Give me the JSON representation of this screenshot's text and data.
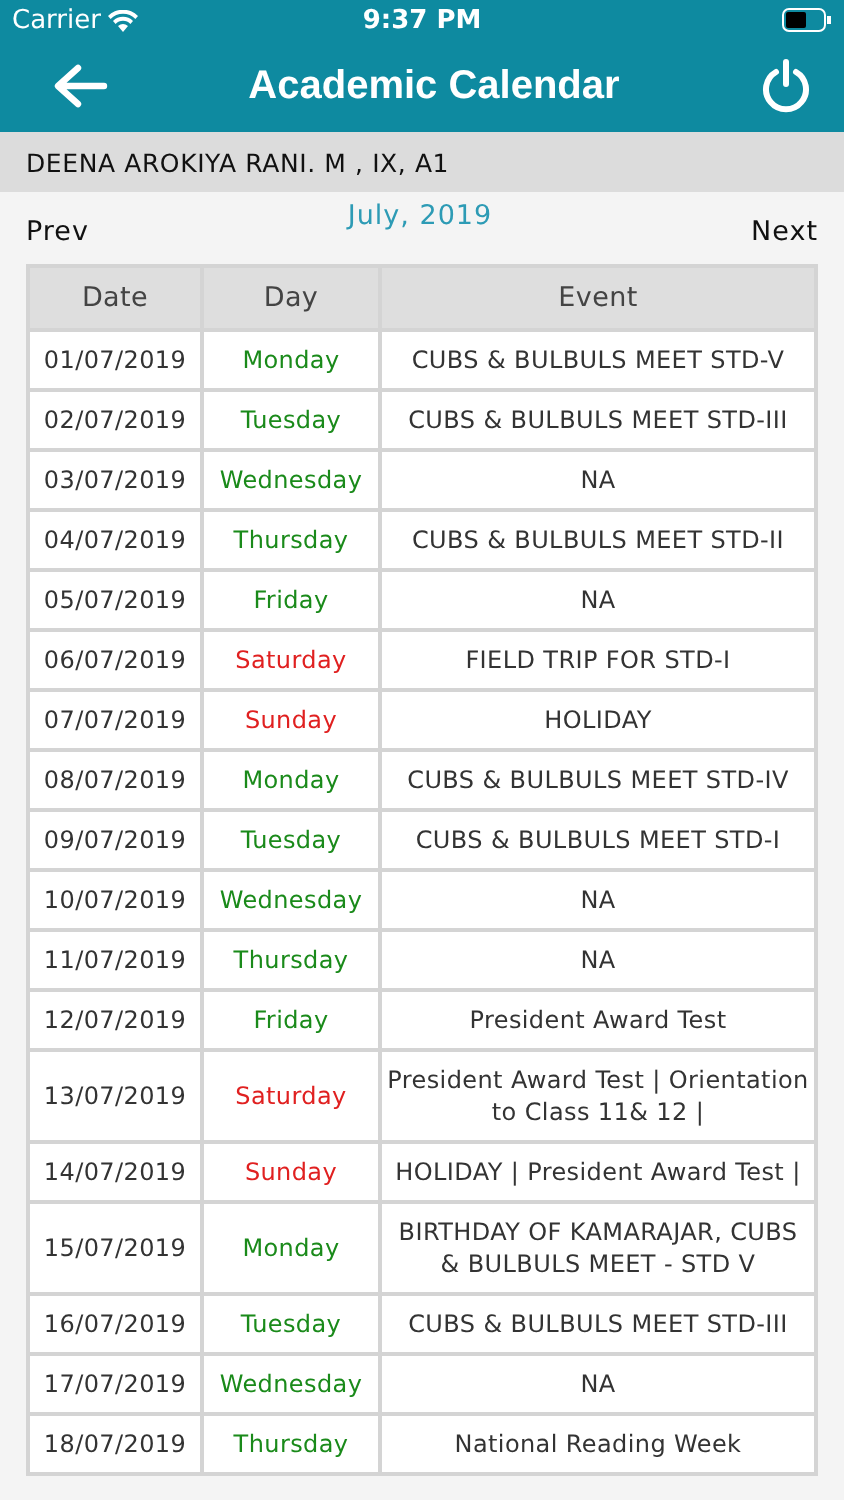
{
  "status_bar": {
    "carrier": "Carrier",
    "time": "9:37 PM"
  },
  "header": {
    "title": "Academic Calendar"
  },
  "student": "DEENA AROKIYA RANI. M , IX, A1",
  "month_nav": {
    "prev": "Prev",
    "month": "July, 2019",
    "next": "Next"
  },
  "table": {
    "columns": [
      "Date",
      "Day",
      "Event"
    ],
    "rows": [
      {
        "date": "01/07/2019",
        "day": "Monday",
        "color": "#1a8a1a",
        "event": "CUBS & BULBULS MEET STD-V"
      },
      {
        "date": "02/07/2019",
        "day": "Tuesday",
        "color": "#1a8a1a",
        "event": "CUBS & BULBULS MEET STD-III"
      },
      {
        "date": "03/07/2019",
        "day": "Wednesday",
        "color": "#1a8a1a",
        "event": "NA"
      },
      {
        "date": "04/07/2019",
        "day": "Thursday",
        "color": "#1a8a1a",
        "event": "CUBS & BULBULS MEET STD-II"
      },
      {
        "date": "05/07/2019",
        "day": "Friday",
        "color": "#1a8a1a",
        "event": "NA"
      },
      {
        "date": "06/07/2019",
        "day": "Saturday",
        "color": "#e02020",
        "event": "FIELD TRIP FOR STD-I"
      },
      {
        "date": "07/07/2019",
        "day": "Sunday",
        "color": "#e02020",
        "event": "HOLIDAY"
      },
      {
        "date": "08/07/2019",
        "day": "Monday",
        "color": "#1a8a1a",
        "event": "CUBS & BULBULS MEET STD-IV"
      },
      {
        "date": "09/07/2019",
        "day": "Tuesday",
        "color": "#1a8a1a",
        "event": "CUBS & BULBULS MEET STD-I"
      },
      {
        "date": "10/07/2019",
        "day": "Wednesday",
        "color": "#1a8a1a",
        "event": "NA"
      },
      {
        "date": "11/07/2019",
        "day": "Thursday",
        "color": "#1a8a1a",
        "event": "NA"
      },
      {
        "date": "12/07/2019",
        "day": "Friday",
        "color": "#1a8a1a",
        "event": "President Award Test"
      },
      {
        "date": "13/07/2019",
        "day": "Saturday",
        "color": "#e02020",
        "event": "President Award Test | Orientation to Class 11& 12 |"
      },
      {
        "date": "14/07/2019",
        "day": "Sunday",
        "color": "#e02020",
        "event": "HOLIDAY | President Award Test |"
      },
      {
        "date": "15/07/2019",
        "day": "Monday",
        "color": "#1a8a1a",
        "event": "BIRTHDAY OF KAMARAJAR, CUBS & BULBULS MEET - STD V"
      },
      {
        "date": "16/07/2019",
        "day": "Tuesday",
        "color": "#1a8a1a",
        "event": "CUBS & BULBULS MEET STD-III"
      },
      {
        "date": "17/07/2019",
        "day": "Wednesday",
        "color": "#1a8a1a",
        "event": "NA"
      },
      {
        "date": "18/07/2019",
        "day": "Thursday",
        "color": "#1a8a1a",
        "event": "National Reading Week"
      }
    ]
  }
}
